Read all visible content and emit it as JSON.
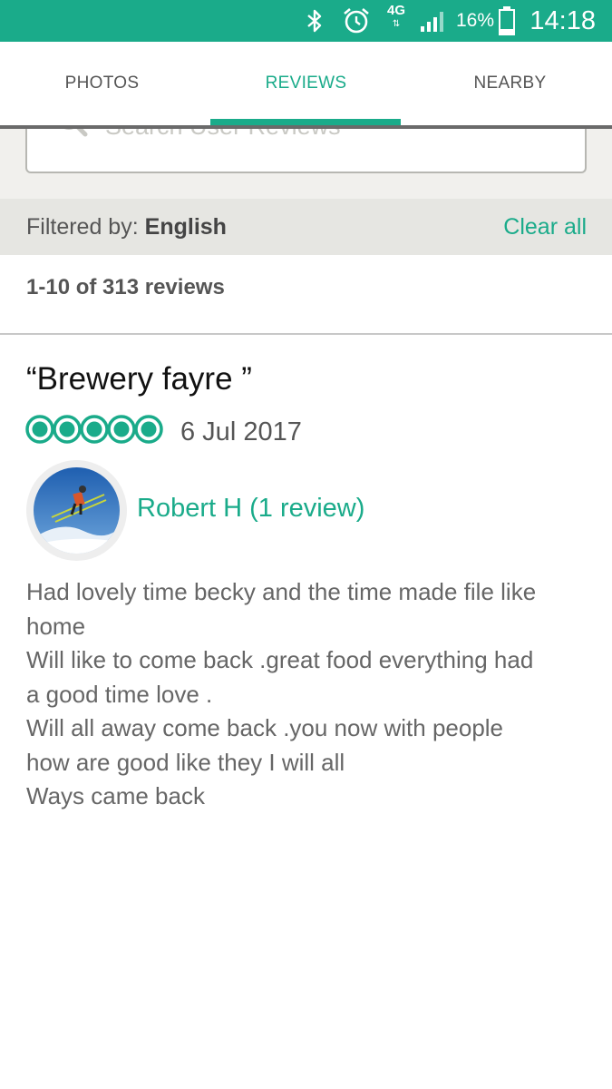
{
  "status_bar": {
    "network": "4G",
    "battery": "16%",
    "time": "14:18",
    "icons": [
      "bluetooth-icon",
      "alarm-icon",
      "signal-icon",
      "battery-icon"
    ]
  },
  "tabs": [
    {
      "label": "PHOTOS",
      "active": false
    },
    {
      "label": "REVIEWS",
      "active": true
    },
    {
      "label": "NEARBY",
      "active": false
    }
  ],
  "search": {
    "placeholder": "Search User Reviews"
  },
  "filter": {
    "prefix": "Filtered by:",
    "value": "English",
    "clear_label": "Clear all"
  },
  "results": {
    "count_text": "1-10 of 313 reviews"
  },
  "review": {
    "title": "“Brewery fayre ”",
    "rating": 5,
    "rating_max": 5,
    "date": "6 Jul 2017",
    "reviewer": "Robert H (1 review)",
    "body_lines": [
      "Had lovely time becky and the time made file like",
      "home",
      "Will like to come back .great food everything had",
      "a good time love .",
      "Will all away come back .you now with people",
      "how are good like they I will all",
      "Ways came back"
    ]
  },
  "colors": {
    "accent": "#1aab8a",
    "filter_bg": "#e6e6e2",
    "search_bg": "#f1f0ed"
  }
}
